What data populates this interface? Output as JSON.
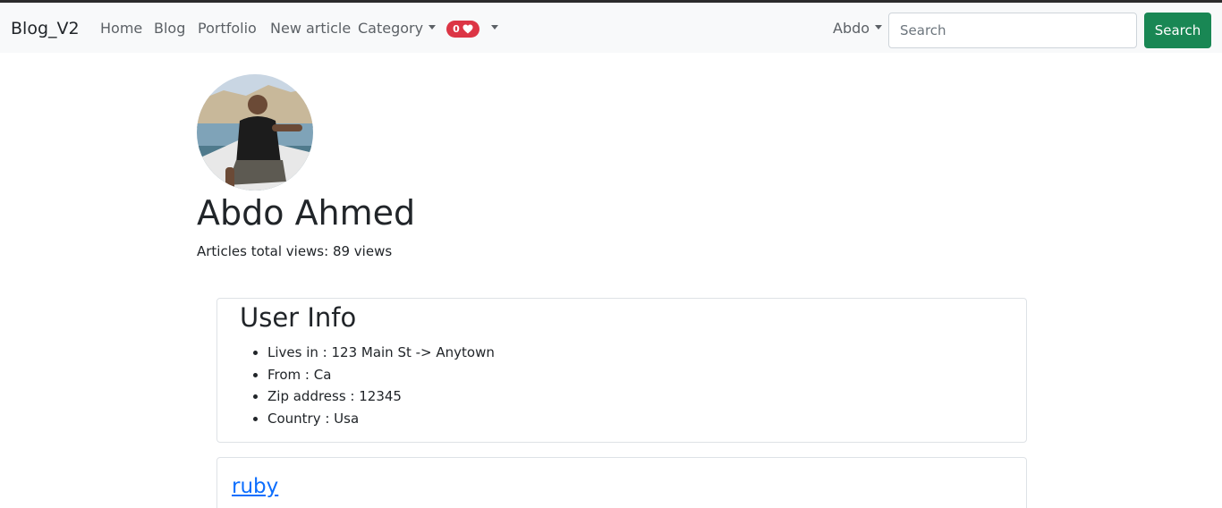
{
  "navbar": {
    "brand": "Blog_V2",
    "links": [
      "Home",
      "Blog",
      "Portfolio",
      "New article"
    ],
    "category_label": "Category",
    "likes_count": "0",
    "user_menu_label": "Abdo",
    "search_placeholder": "Search",
    "search_button_label": "Search",
    "accent_color": "#198754",
    "badge_color": "#dc3545"
  },
  "profile": {
    "name": "Abdo Ahmed",
    "views_text": "Articles total views: 89 views"
  },
  "user_info": {
    "title": "User Info",
    "items": [
      "Lives in : 123 Main St -> Anytown",
      "From : Ca",
      "Zip address : 12345",
      "Country : Usa"
    ]
  },
  "articles": [
    {
      "title": "ruby"
    }
  ]
}
